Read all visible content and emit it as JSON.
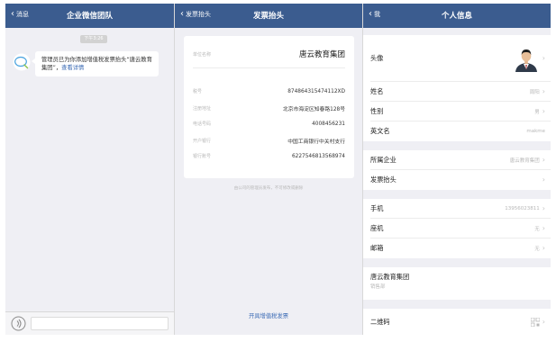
{
  "chat": {
    "back_label": "消息",
    "title": "企业微信团队",
    "time_pill": "下午3:26",
    "message_text": "管理员已为你添加增值税发票抬头“唐云教育集团”，",
    "message_link": "查看详情"
  },
  "invoice": {
    "back_label": "发票抬头",
    "title": "发票抬头",
    "company_label": "单位名称",
    "company_name": "唐云教育集团",
    "fields": [
      {
        "label": "税号",
        "value": "874864315474112XD"
      },
      {
        "label": "注册地址",
        "value": "北京市海淀区知春路128号"
      },
      {
        "label": "电话号码",
        "value": "4008456231"
      },
      {
        "label": "开户银行",
        "value": "中国工商银行中关村支行"
      },
      {
        "label": "银行账号",
        "value": "6227546813568974"
      }
    ],
    "note": "由公司的管理员发布，不可修改或删除",
    "action_link": "开具增值税发票"
  },
  "profile": {
    "back_label": "我",
    "title": "个人信息",
    "avatar_label": "头像",
    "name_label": "姓名",
    "name_value": "周阳",
    "gender_label": "性别",
    "gender_value": "男",
    "english_label": "英文名",
    "english_value": "makme",
    "company_label": "所属企业",
    "company_value": "唐云教育集团",
    "invoice_label": "发票抬头",
    "mobile_label": "手机",
    "mobile_value": "13956023811",
    "landline_label": "座机",
    "landline_value": "无",
    "email_label": "邮箱",
    "email_value": "无",
    "org_name": "唐云教育集团",
    "org_dept": "销售部",
    "qr_label": "二维码"
  }
}
